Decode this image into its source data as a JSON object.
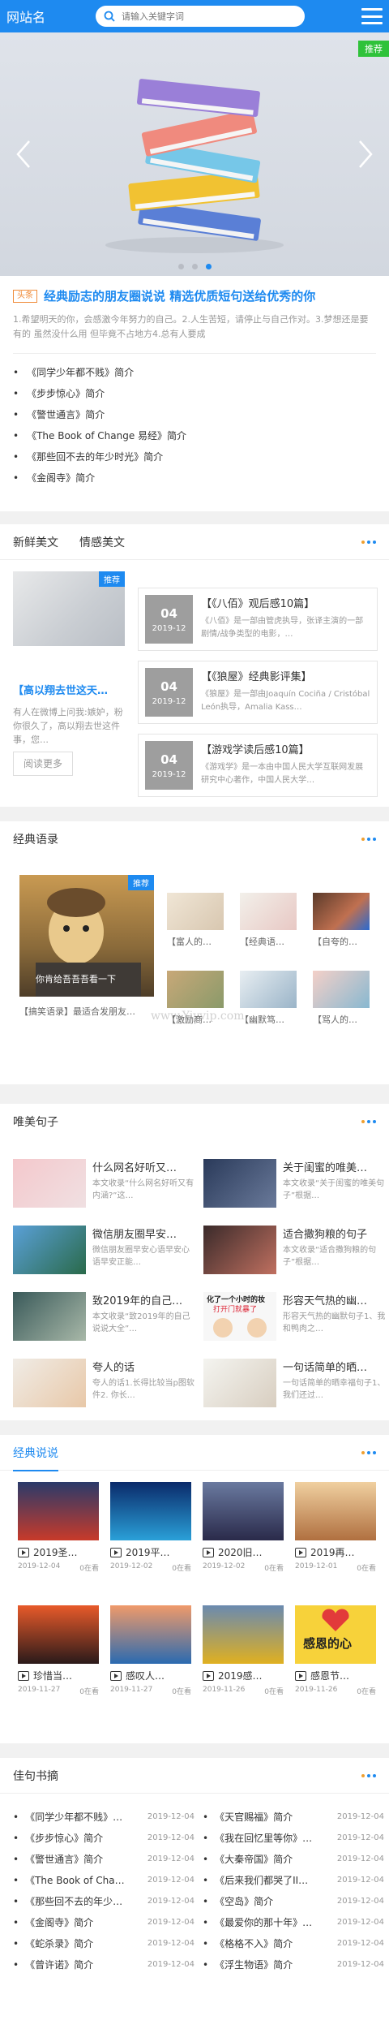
{
  "header": {
    "logo": "网站名",
    "search_placeholder": "请输入关键字词"
  },
  "banner": {
    "tag": "推荐"
  },
  "headline": {
    "tag": "头条",
    "title": "经典励志的朋友圈说说 精选优质短句送给优秀的你",
    "desc": "1.希望明天的你，会感激今年努力的自己。2.人生苦短，请停止与自己作对。3.梦想还是要有的 虽然没什么用 但毕竟不占地方4.总有人要成",
    "links": [
      "《同学少年都不贱》简介",
      "《步步惊心》简介",
      "《警世通言》简介",
      "《The Book of Change 易经》简介",
      "《那些回不去的年少时光》简介",
      "《金阁寺》简介"
    ]
  },
  "articles": {
    "tabs": [
      "新鲜美文",
      "情感美文"
    ],
    "featured": {
      "badge": "推荐",
      "title": "【高以翔去世这天…",
      "desc": "有人在微博上问我:嫉妒，粉你很久了，高以翔去世这件事，您…",
      "more": "阅读更多"
    },
    "items": [
      {
        "day": "04",
        "ym": "2019-12",
        "title": "【《八佰》观后感10篇】",
        "desc": "《八佰》是一部由管虎执导，张译主演的一部剧情/战争类型的电影，…"
      },
      {
        "day": "04",
        "ym": "2019-12",
        "title": "【《狼屋》经典影评集】",
        "desc": "《狼屋》是一部由Joaquín Cociña / Cristóbal León执导，Amalia Kass…"
      },
      {
        "day": "04",
        "ym": "2019-12",
        "title": "【游戏学读后感10篇】",
        "desc": "《游戏学》是一本由中国人民大学互联网发展研究中心著作，中国人民大学…"
      }
    ]
  },
  "quotes": {
    "title": "经典语录",
    "featured": {
      "badge": "推荐",
      "subtitle": "你肯给吾吾吾看一下",
      "caption": "【搞笑语录】最适合发朋友…"
    },
    "items": [
      "【富人的…",
      "【经典语…",
      "【自夸的…",
      "【激励商…",
      "【幽默笃…",
      "【骂人的…"
    ],
    "watermark": "www.Yiyvip.com"
  },
  "sentences": {
    "title": "唯美句子",
    "items": [
      {
        "title": "什么网名好听又…",
        "desc": "本文收录“什么网名好听又有内涵?”这…"
      },
      {
        "title": "关于闺蜜的唯美…",
        "desc": "本文收录“关于闺蜜的唯美句子”根据…"
      },
      {
        "title": "微信朋友圈早安…",
        "desc": "微信朋友圈早安心语早安心语早安正能…"
      },
      {
        "title": "适合撒狗粮的句子",
        "desc": "本文收录“适合撒狗粮的句子”根据…"
      },
      {
        "title": "致2019年的自己…",
        "desc": "本文收录“致2019年的自己说说大全”…"
      },
      {
        "title": "形容天气热的幽…",
        "desc": "形容天气热的幽默句子1、我和鸭肉之…"
      },
      {
        "title": "夸人的话",
        "desc": "夸人的话1.长得比较当p图软件2. 你长…"
      },
      {
        "title": "一句话简单的晒…",
        "desc": "一句话简单的晒幸福句子1、我们还过…"
      }
    ],
    "img_text_a": "化了一个小时的妆",
    "img_text_b": "打开门就暴了"
  },
  "sayings": {
    "title": "经典说说",
    "img_text": "感恩的心",
    "items": [
      {
        "title": "2019圣…",
        "date": "2019-12-04",
        "views": "0在看"
      },
      {
        "title": "2019平…",
        "date": "2019-12-02",
        "views": "0在看"
      },
      {
        "title": "2020旧…",
        "date": "2019-12-02",
        "views": "0在看"
      },
      {
        "title": "2019再…",
        "date": "2019-12-01",
        "views": "0在看"
      },
      {
        "title": "珍惜当…",
        "date": "2019-11-27",
        "views": "0在看"
      },
      {
        "title": "感叹人…",
        "date": "2019-11-27",
        "views": "0在看"
      },
      {
        "title": "2019感…",
        "date": "2019-11-26",
        "views": "0在看"
      },
      {
        "title": "感恩节…",
        "date": "2019-11-26",
        "views": "0在看"
      }
    ]
  },
  "books": {
    "title": "佳句书摘",
    "left": [
      {
        "name": "《同学少年都不贱》…",
        "date": "2019-12-04"
      },
      {
        "name": "《步步惊心》简介",
        "date": "2019-12-04"
      },
      {
        "name": "《警世通言》简介",
        "date": "2019-12-04"
      },
      {
        "name": "《The Book of Cha…",
        "date": "2019-12-04"
      },
      {
        "name": "《那些回不去的年少…",
        "date": "2019-12-04"
      },
      {
        "name": "《金阁寺》简介",
        "date": "2019-12-04"
      },
      {
        "name": "《蛇杀录》简介",
        "date": "2019-12-04"
      },
      {
        "name": "《曾许诺》简介",
        "date": "2019-12-04"
      }
    ],
    "right": [
      {
        "name": "《天官赐福》简介",
        "date": "2019-12-04"
      },
      {
        "name": "《我在回忆里等你》…",
        "date": "2019-12-04"
      },
      {
        "name": "《大秦帝国》简介",
        "date": "2019-12-04"
      },
      {
        "name": "《后来我们都哭了II…",
        "date": "2019-12-04"
      },
      {
        "name": "《空岛》简介",
        "date": "2019-12-04"
      },
      {
        "name": "《最爱你的那十年》…",
        "date": "2019-12-04"
      },
      {
        "name": "《格格不入》简介",
        "date": "2019-12-04"
      },
      {
        "name": "《浮生物语》简介",
        "date": "2019-12-04"
      }
    ]
  }
}
